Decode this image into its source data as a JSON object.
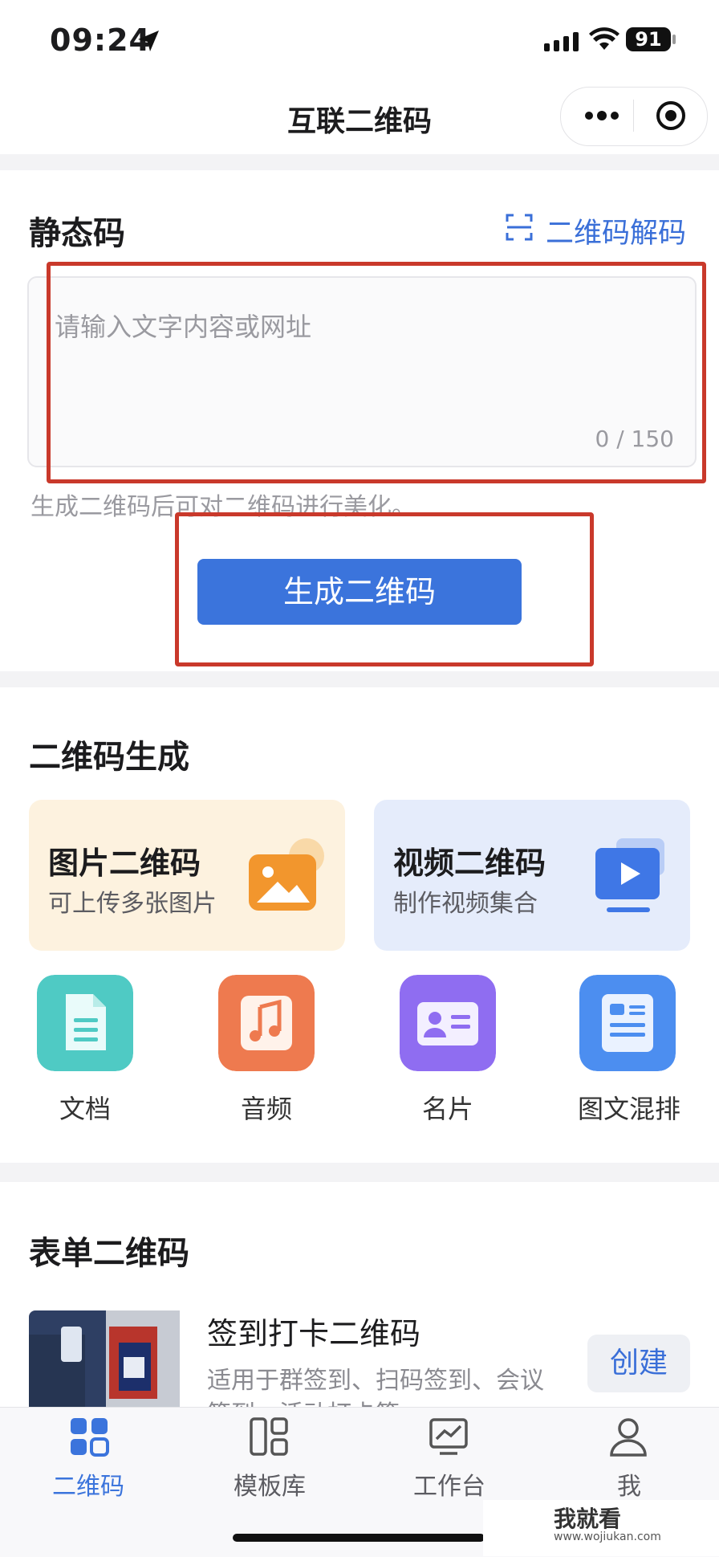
{
  "status_bar": {
    "time": "09:24",
    "battery": "91"
  },
  "nav": {
    "title": "互联二维码"
  },
  "static_code": {
    "title": "静态码",
    "decode_label": "二维码解码",
    "input_placeholder": "请输入文字内容或网址",
    "counter": "0 / 150",
    "hint": "生成二维码后可对二维码进行美化。",
    "generate_button": "生成二维码"
  },
  "qr_generate": {
    "title": "二维码生成",
    "cards": [
      {
        "title": "图片二维码",
        "subtitle": "可上传多张图片"
      },
      {
        "title": "视频二维码",
        "subtitle": "制作视频集合"
      }
    ],
    "tiles": [
      {
        "label": "文档",
        "icon": "document-icon"
      },
      {
        "label": "音频",
        "icon": "music-icon"
      },
      {
        "label": "名片",
        "icon": "business-card-icon"
      },
      {
        "label": "图文混排",
        "icon": "article-icon"
      }
    ]
  },
  "form_code": {
    "title": "表单二维码",
    "item": {
      "title": "签到打卡二维码",
      "desc_line1": "适用于群签到、扫码签到、会议",
      "desc_line2": "签到、活动打卡等",
      "create_button": "创建"
    }
  },
  "tabbar": [
    {
      "label": "二维码",
      "icon": "qrcode-grid-icon",
      "active": true
    },
    {
      "label": "模板库",
      "icon": "template-icon",
      "active": false
    },
    {
      "label": "工作台",
      "icon": "workbench-icon",
      "active": false
    },
    {
      "label": "我",
      "icon": "profile-icon",
      "active": false
    }
  ],
  "watermark": {
    "brand": "我就看",
    "url": "www.wojiukan.com"
  },
  "colors": {
    "accent": "#3b74dc",
    "annotation_red": "#c9392b",
    "page_bg": "#f3f3f5"
  }
}
